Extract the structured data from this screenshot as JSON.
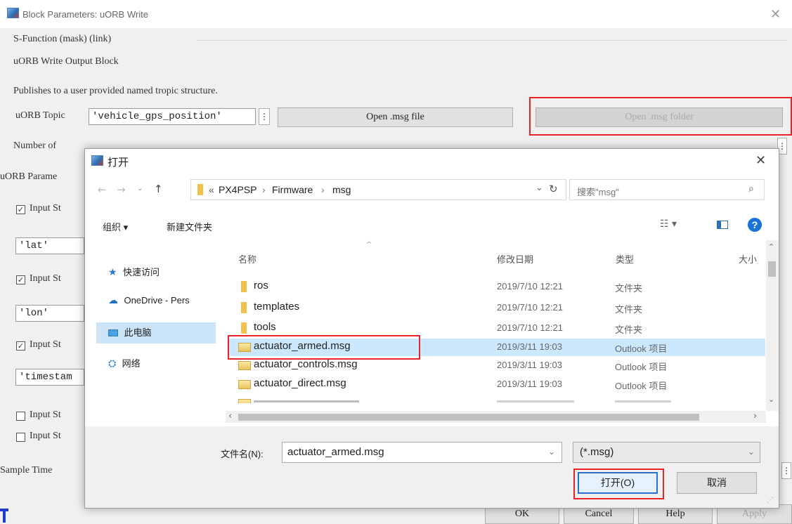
{
  "block_dialog": {
    "title": "Block Parameters: uORB Write",
    "section_title": "S-Function (mask) (link)",
    "block_name": "uORB Write Output Block",
    "description": "Publishes to a user provided named tropic structure.",
    "topic_label": "uORB Topic",
    "topic_value": "'vehicle_gps_position'",
    "topic_menu_glyph": "⋮",
    "open_msg_file_label": "Open .msg file",
    "open_msg_folder_label": "Open .msg folder",
    "number_of_label": "Number of",
    "number_spinner_glyph": "⋮",
    "params_label": "uORB Parame",
    "input_rows": [
      {
        "label": "Input St",
        "checked": true,
        "value": "'lat'"
      },
      {
        "label": "Input St",
        "checked": true,
        "value": "'lon'"
      },
      {
        "label": "Input St",
        "checked": true,
        "value": "'timestam"
      },
      {
        "label": "Input St",
        "checked": false
      },
      {
        "label": "Input St",
        "checked": false
      }
    ],
    "sample_time_label": "Sample Time",
    "sample_time_glyph": "⋮",
    "buttons": {
      "ok": "OK",
      "cancel": "Cancel",
      "help": "Help",
      "apply": "Apply"
    }
  },
  "file_dialog": {
    "title": "打开",
    "breadcrumb": {
      "prefix": "«",
      "parts": [
        "PX4PSP",
        "Firmware",
        "msg"
      ]
    },
    "search_placeholder": "搜索\"msg\"",
    "toolbar": {
      "organize": "组织 ▾",
      "new_folder": "新建文件夹"
    },
    "nav": [
      {
        "label": "快速访问",
        "icon": "star-icon"
      },
      {
        "label": "OneDrive - Pers",
        "icon": "cloud-icon"
      },
      {
        "label": "此电脑",
        "icon": "pc-icon",
        "selected": true
      },
      {
        "label": "网络",
        "icon": "network-icon"
      }
    ],
    "columns": {
      "name": "名称",
      "date": "修改日期",
      "type": "类型",
      "size": "大小"
    },
    "files": [
      {
        "name": "ros",
        "date": "2019/7/10 12:21",
        "type": "文件夹",
        "kind": "folder"
      },
      {
        "name": "templates",
        "date": "2019/7/10 12:21",
        "type": "文件夹",
        "kind": "folder"
      },
      {
        "name": "tools",
        "date": "2019/7/10 12:21",
        "type": "文件夹",
        "kind": "folder"
      },
      {
        "name": "actuator_armed.msg",
        "date": "2019/3/11 19:03",
        "type": "Outlook 项目",
        "kind": "msg",
        "selected": true
      },
      {
        "name": "actuator_controls.msg",
        "date": "2019/3/11 19:03",
        "type": "Outlook 项目",
        "kind": "msg"
      },
      {
        "name": "actuator_direct.msg",
        "date": "2019/3/11 19:03",
        "type": "Outlook 项目",
        "kind": "msg"
      }
    ],
    "filename_label": "文件名(N):",
    "filename_value": "actuator_armed.msg",
    "filter_value": "(*.msg)",
    "open_button": "打开(O)",
    "cancel_button": "取消"
  }
}
